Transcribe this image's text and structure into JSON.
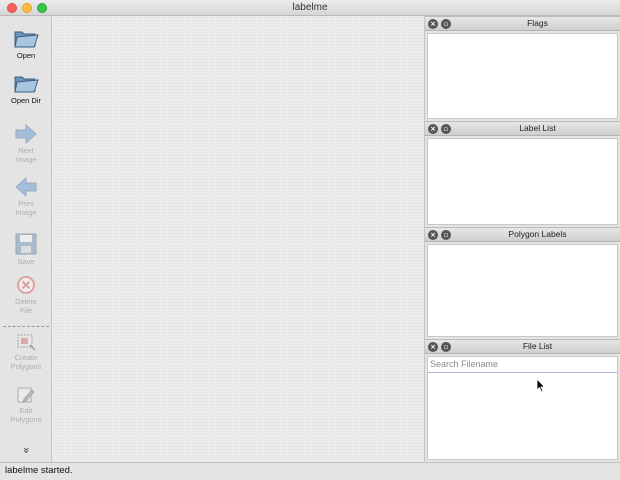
{
  "window": {
    "title": "labelme"
  },
  "toolbar": {
    "items": [
      {
        "label": "Open",
        "icon": "folder-open-icon",
        "enabled": true
      },
      {
        "label": "Open Dir",
        "icon": "folder-open-icon",
        "enabled": true
      },
      {
        "label": "Next Image",
        "icon": "arrow-right-icon",
        "enabled": false
      },
      {
        "label": "Prev Image",
        "icon": "arrow-left-icon",
        "enabled": false
      },
      {
        "label": "Save",
        "icon": "save-icon",
        "enabled": false
      },
      {
        "label": "Delete File",
        "icon": "delete-icon",
        "enabled": false
      },
      {
        "label": "Create Polygons",
        "icon": "create-polygon-icon",
        "enabled": false
      },
      {
        "label": "Edit Polygons",
        "icon": "edit-polygon-icon",
        "enabled": false
      }
    ],
    "more_icon": "double-chevron-down-icon",
    "more_glyph": "»"
  },
  "docks": {
    "flags": {
      "title": "Flags"
    },
    "label_list": {
      "title": "Label List"
    },
    "polygon_labels": {
      "title": "Polygon Labels"
    },
    "file_list": {
      "title": "File List",
      "search_placeholder": "Search Filename"
    }
  },
  "status": {
    "message": "labelme started."
  },
  "colors": {
    "folder": "#7fa6c9",
    "arrow": "#3d7fcf",
    "delete": "#d23a3a",
    "traffic_close": "#fc605c",
    "traffic_min": "#fdbc40",
    "traffic_max": "#34c84a"
  }
}
